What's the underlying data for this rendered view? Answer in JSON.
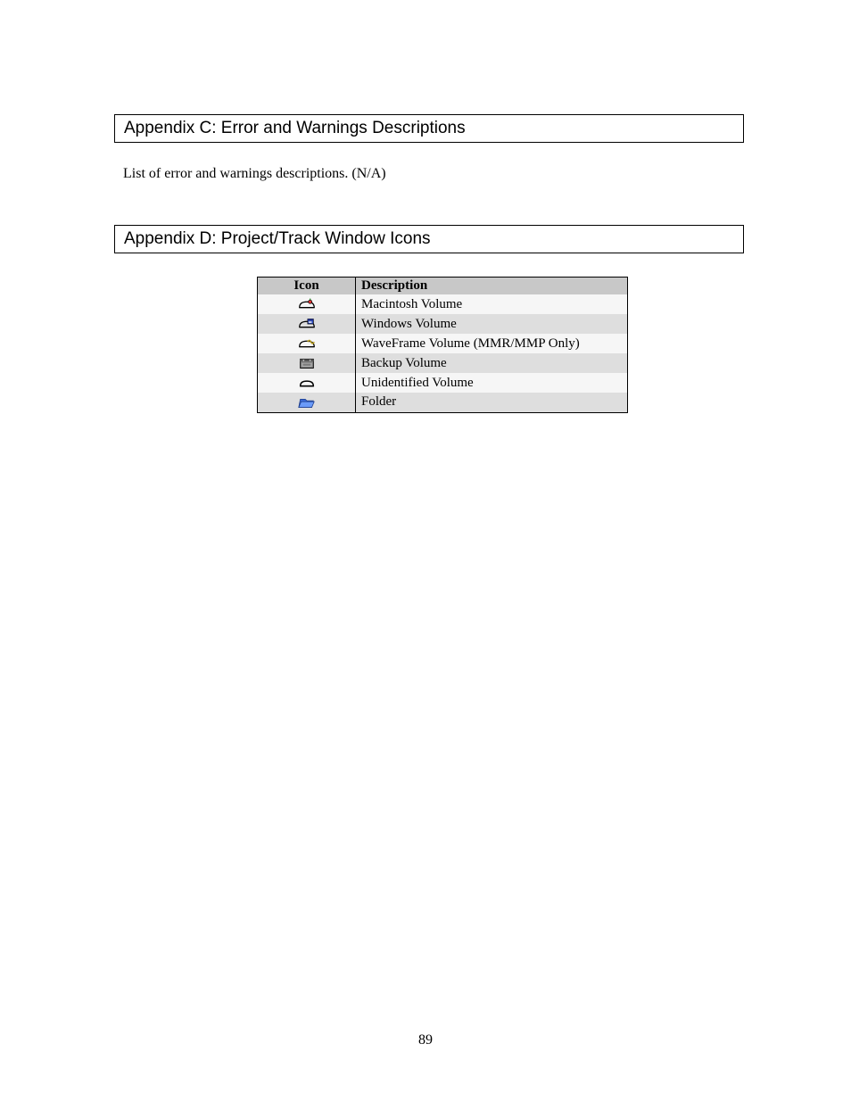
{
  "appendix_c": {
    "heading": "Appendix C: Error and Warnings Descriptions",
    "body": "List of error and warnings descriptions. (N/A)"
  },
  "appendix_d": {
    "heading": "Appendix D: Project/Track Window Icons",
    "table": {
      "header_icon": "Icon",
      "header_desc": "Description",
      "rows": [
        {
          "icon": "macintosh-volume-icon",
          "desc": "Macintosh Volume"
        },
        {
          "icon": "windows-volume-icon",
          "desc": "Windows Volume"
        },
        {
          "icon": "waveframe-volume-icon",
          "desc": "WaveFrame Volume (MMR/MMP Only)"
        },
        {
          "icon": "backup-volume-icon",
          "desc": "Backup Volume"
        },
        {
          "icon": "unidentified-volume-icon",
          "desc": "Unidentified Volume"
        },
        {
          "icon": "folder-icon",
          "desc": "Folder"
        }
      ]
    }
  },
  "page_number": "89"
}
